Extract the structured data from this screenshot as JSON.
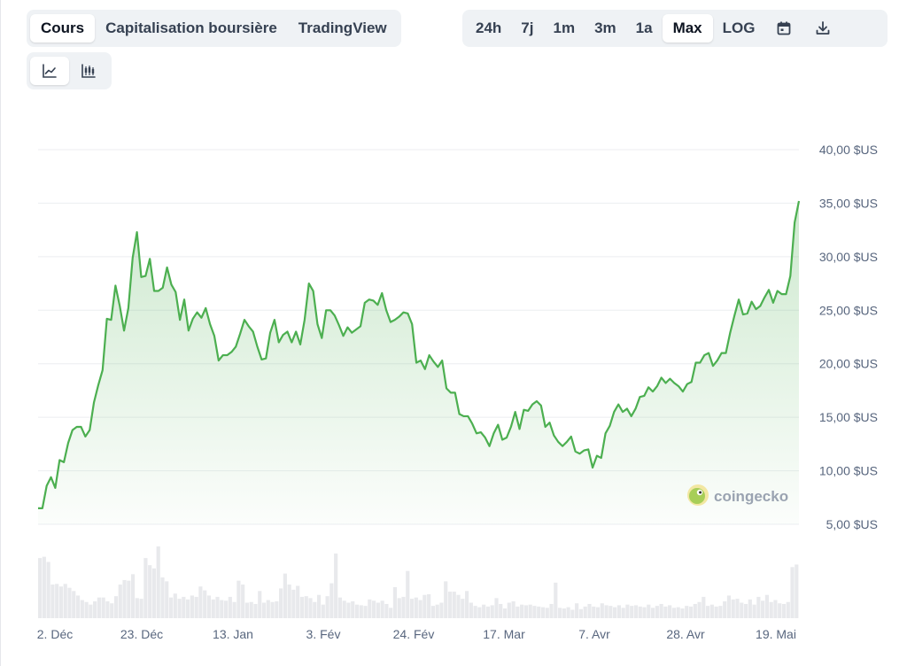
{
  "tabs": {
    "items": [
      {
        "label": "Cours",
        "active": true
      },
      {
        "label": "Capitalisation boursière",
        "active": false
      },
      {
        "label": "TradingView",
        "active": false
      }
    ]
  },
  "ranges": {
    "items": [
      {
        "label": "24h",
        "active": false
      },
      {
        "label": "7j",
        "active": false
      },
      {
        "label": "1m",
        "active": false
      },
      {
        "label": "3m",
        "active": false
      },
      {
        "label": "1a",
        "active": false
      },
      {
        "label": "Max",
        "active": true
      },
      {
        "label": "LOG",
        "active": false
      }
    ],
    "icons": [
      "calendar-icon",
      "download-icon"
    ]
  },
  "chart_types": {
    "items": [
      {
        "icon": "line-chart-icon",
        "active": true
      },
      {
        "icon": "candlestick-chart-icon",
        "active": false
      }
    ]
  },
  "watermark": {
    "text": "coingecko",
    "icon": "coingecko-logo-icon"
  },
  "colors": {
    "line": "#4caf50",
    "fill_top": "#d4ecd5",
    "volume": "#e8e9ec",
    "grid": "#eceef1",
    "axis_text": "#58667e",
    "active_bg": "#ffffff",
    "segment_bg": "#eff2f5"
  },
  "chart_data": {
    "type": "line",
    "ylabels": [
      "40,00 $US",
      "35,00 $US",
      "30,00 $US",
      "25,00 $US",
      "20,00 $US",
      "15,00 $US",
      "10,00 $US",
      "5,00 $US"
    ],
    "ylim": [
      5,
      40
    ],
    "yticks": [
      40,
      35,
      30,
      25,
      20,
      15,
      10,
      5
    ],
    "xlabels": [
      "2. Déc",
      "23. Déc",
      "13. Jan",
      "3. Fév",
      "24. Fév",
      "17. Mar",
      "7. Avr",
      "28. Avr",
      "19. Mai"
    ],
    "grid": true,
    "series": [
      {
        "values": [
          6.5,
          6.5,
          8.6,
          9.4,
          8.4,
          11.0,
          10.8,
          12.6,
          13.8,
          14.1,
          14.1,
          13.2,
          13.8,
          16.4,
          18.0,
          19.4,
          24.2,
          24.1,
          27.3,
          25.4,
          23.1,
          25.2,
          29.9,
          32.3,
          28.1,
          28.2,
          29.8,
          26.8,
          26.8,
          27.1,
          29.0,
          27.4,
          26.7,
          24.1,
          26.0,
          23.1,
          24.2,
          24.8,
          24.3,
          25.2,
          23.7,
          22.6,
          20.3,
          20.8,
          20.8,
          21.1,
          21.6,
          22.8,
          24.1,
          23.5,
          23.0,
          21.6,
          20.4,
          20.5,
          22.9,
          24.1,
          22.0,
          22.7,
          23.0,
          22.0,
          23.0,
          21.8,
          24.1,
          27.5,
          26.8,
          23.7,
          22.4,
          25.0,
          25.0,
          24.5,
          23.6,
          22.6,
          23.4,
          22.9,
          23.2,
          23.5,
          25.7,
          26.0,
          25.9,
          25.5,
          26.6,
          25.0,
          23.9,
          24.1,
          24.4,
          24.8,
          24.7,
          23.7,
          20.1,
          20.3,
          19.5,
          20.8,
          20.2,
          19.7,
          20.3,
          17.7,
          17.3,
          17.3,
          15.3,
          15.1,
          15.1,
          14.4,
          13.5,
          13.6,
          13.1,
          12.3,
          13.5,
          14.3,
          12.9,
          13.1,
          14.1,
          15.5,
          13.9,
          15.7,
          15.6,
          16.2,
          16.5,
          16.1,
          14.1,
          14.5,
          13.3,
          12.7,
          12.3,
          12.7,
          13.2,
          11.8,
          11.6,
          11.9,
          12.0,
          10.3,
          11.4,
          11.2,
          13.5,
          14.2,
          15.5,
          16.2,
          15.5,
          15.8,
          15.1,
          15.8,
          16.9,
          17.0,
          17.8,
          17.4,
          17.9,
          18.7,
          18.2,
          18.6,
          18.2,
          17.9,
          17.4,
          18.1,
          18.3,
          20.1,
          20.1,
          20.8,
          21.0,
          19.8,
          20.3,
          21.0,
          21.0,
          22.9,
          24.5,
          26.0,
          24.6,
          24.7,
          25.8,
          25.1,
          25.4,
          26.2,
          26.9,
          25.7,
          26.8,
          26.5,
          26.5,
          28.2,
          33.2,
          35.2
        ]
      }
    ],
    "volume": [
      0.93,
      0.95,
      0.87,
      0.52,
      0.53,
      0.49,
      0.53,
      0.47,
      0.42,
      0.35,
      0.28,
      0.25,
      0.21,
      0.26,
      0.32,
      0.32,
      0.26,
      0.23,
      0.34,
      0.52,
      0.59,
      0.58,
      0.68,
      0.31,
      0.3,
      0.93,
      0.82,
      0.77,
      1.11,
      0.63,
      0.57,
      0.32,
      0.38,
      0.3,
      0.33,
      0.29,
      0.35,
      0.33,
      0.49,
      0.43,
      0.35,
      0.29,
      0.33,
      0.28,
      0.27,
      0.33,
      0.25,
      0.58,
      0.52,
      0.24,
      0.25,
      0.22,
      0.42,
      0.24,
      0.28,
      0.25,
      0.26,
      0.46,
      0.69,
      0.52,
      0.44,
      0.5,
      0.33,
      0.34,
      0.31,
      0.25,
      0.36,
      0.21,
      0.34,
      0.54,
      1.0,
      0.32,
      0.27,
      0.24,
      0.26,
      0.21,
      0.2,
      0.19,
      0.29,
      0.27,
      0.24,
      0.27,
      0.22,
      0.16,
      0.48,
      0.31,
      0.33,
      0.73,
      0.3,
      0.32,
      0.28,
      0.36,
      0.37,
      0.19,
      0.21,
      0.24,
      0.57,
      0.41,
      0.41,
      0.36,
      0.3,
      0.42,
      0.24,
      0.19,
      0.17,
      0.21,
      0.18,
      0.2,
      0.31,
      0.22,
      0.15,
      0.24,
      0.26,
      0.18,
      0.21,
      0.2,
      0.21,
      0.19,
      0.18,
      0.17,
      0.16,
      0.22,
      0.55,
      0.16,
      0.15,
      0.17,
      0.13,
      0.23,
      0.14,
      0.18,
      0.22,
      0.18,
      0.17,
      0.23,
      0.2,
      0.19,
      0.17,
      0.2,
      0.16,
      0.21,
      0.19,
      0.2,
      0.18,
      0.17,
      0.21,
      0.16,
      0.19,
      0.22,
      0.18,
      0.2,
      0.16,
      0.17,
      0.15,
      0.19,
      0.18,
      0.22,
      0.25,
      0.33,
      0.19,
      0.21,
      0.18,
      0.19,
      0.26,
      0.35,
      0.29,
      0.3,
      0.24,
      0.22,
      0.29,
      0.21,
      0.33,
      0.27,
      0.36,
      0.25,
      0.28,
      0.23,
      0.22,
      0.25,
      0.79,
      0.83
    ]
  }
}
